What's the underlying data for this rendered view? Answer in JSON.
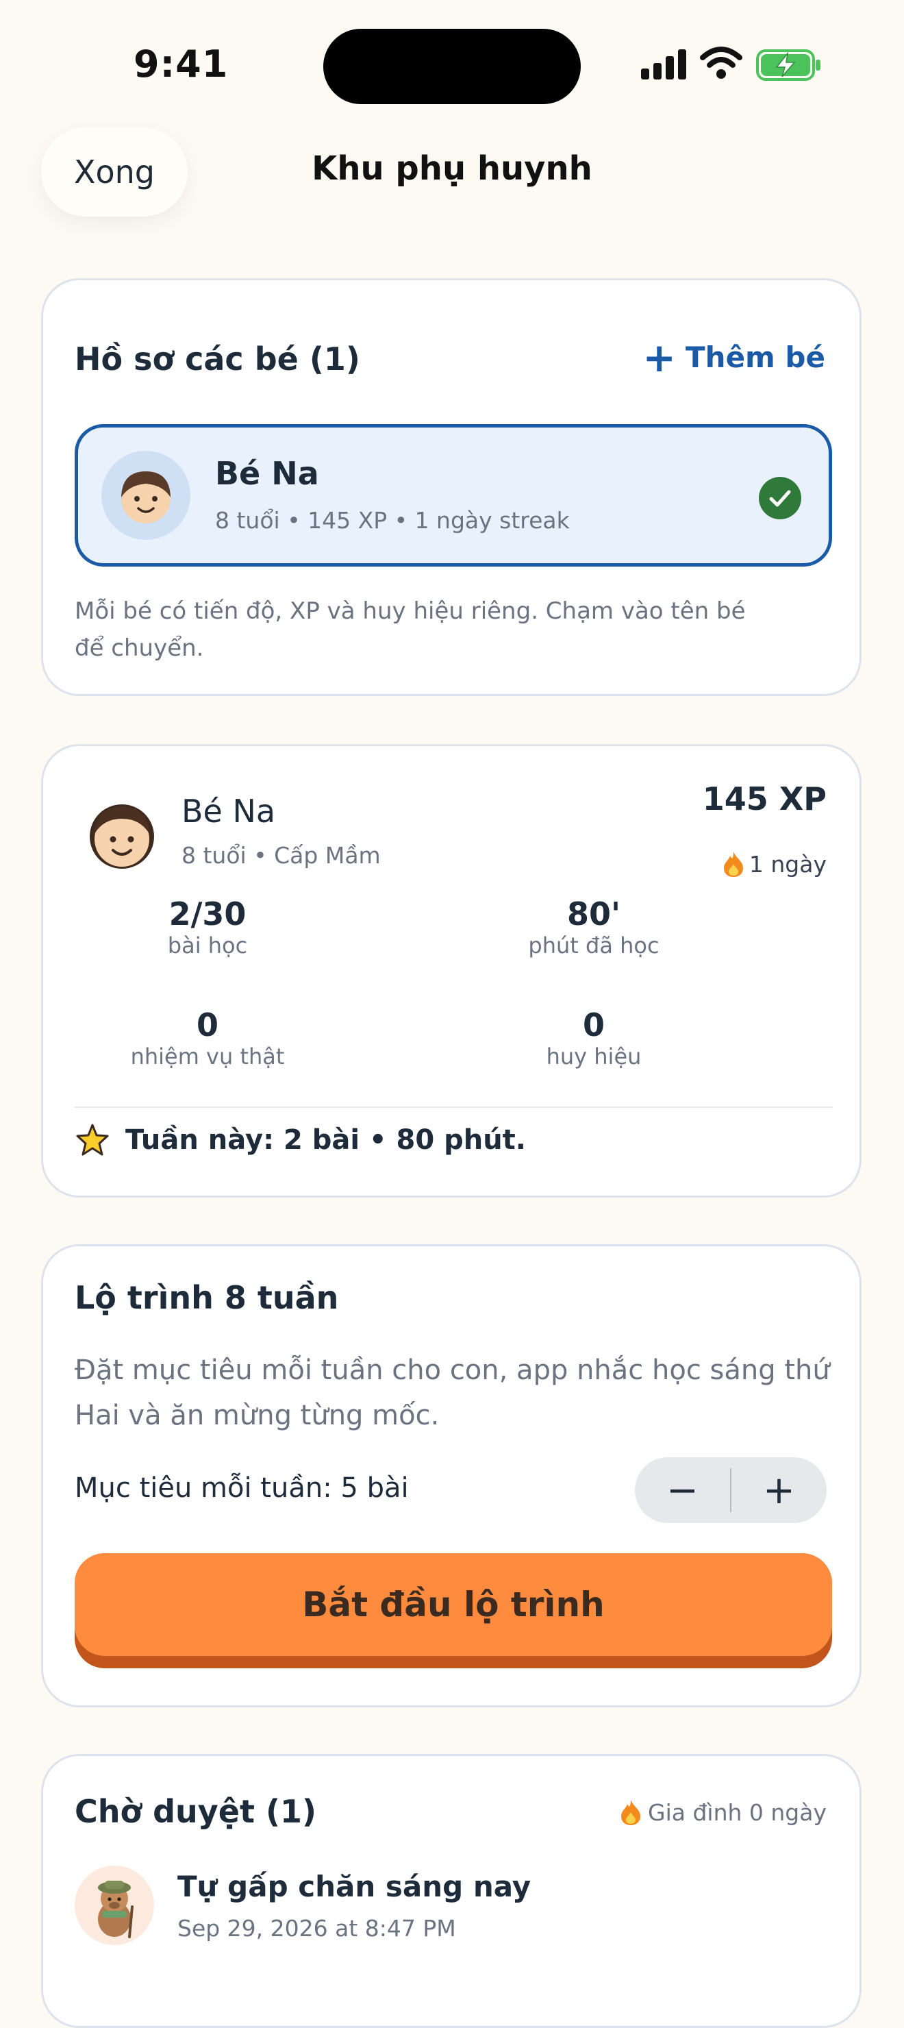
{
  "status_bar": {
    "time": "9:41"
  },
  "header": {
    "done_label": "Xong",
    "title": "Khu phụ huynh"
  },
  "profiles_card": {
    "title": "Hồ sơ các bé (1)",
    "add_label": "Thêm bé",
    "selected_profile": {
      "name": "Bé Na",
      "meta": "8 tuổi • 145 XP • 1 ngày streak"
    },
    "note": "Mỗi bé có tiến độ, XP và huy hiệu riêng. Chạm vào tên bé để chuyển."
  },
  "stats_card": {
    "name": "Bé Na",
    "sub": "8 tuổi • Cấp Mầm",
    "xp": "145 XP",
    "streak": "1 ngày",
    "stats": [
      {
        "value": "2/30",
        "label": "bài học"
      },
      {
        "value": "80'",
        "label": "phút đã học"
      },
      {
        "value": "0",
        "label": "nhiệm vụ thật"
      },
      {
        "value": "0",
        "label": "huy hiệu"
      }
    ],
    "week_summary": "Tuần này: 2 bài • 80 phút."
  },
  "roadmap_card": {
    "title": "Lộ trình 8 tuần",
    "description": "Đặt mục tiêu mỗi tuần cho con, app nhắc học sáng thứ Hai và ăn mừng từng mốc.",
    "goal_label": "Mục tiêu mỗi tuần: 5 bài",
    "minus": "−",
    "plus": "+",
    "start_label": "Bắt đầu lộ trình"
  },
  "pending_card": {
    "title": "Chờ duyệt (1)",
    "family_streak": "Gia đình 0 ngày",
    "item": {
      "title": "Tự gấp chăn sáng nay",
      "date": "Sep 29, 2026 at 8:47 PM"
    }
  },
  "colors": {
    "accent": "#1a5aa6",
    "primary_button": "#ff8b3f",
    "background": "#fdf9f3"
  }
}
